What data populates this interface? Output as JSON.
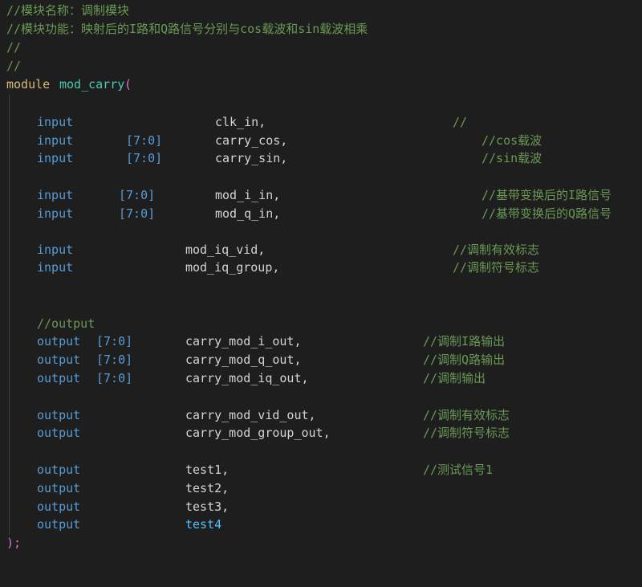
{
  "header_comments": [
    "//模块名称：调制模块",
    "//模块功能：映射后的I路和Q路信号分别与cos载波和sin载波相乘",
    "//",
    "//"
  ],
  "module_decl": {
    "keyword": "module",
    "name": "mod_carry",
    "open_paren": "("
  },
  "ports": [
    {
      "dir": "input",
      "range": "",
      "name": "clk_in,",
      "comment": "//"
    },
    {
      "dir": "input",
      "range": "[7:0]",
      "name": "carry_cos,",
      "comment": "//cos载波"
    },
    {
      "dir": "input",
      "range": "[7:0]",
      "name": "carry_sin,",
      "comment": "//sin载波"
    },
    {
      "dir": "input",
      "range": "[7:0]",
      "name": "mod_i_in,",
      "comment": "//基带变换后的I路信号"
    },
    {
      "dir": "input",
      "range": "[7:0]",
      "name": "mod_q_in,",
      "comment": "//基带变换后的Q路信号"
    },
    {
      "dir": "input",
      "range": "",
      "name": "mod_iq_vid,",
      "comment": "//调制有效标志"
    },
    {
      "dir": "input",
      "range": "",
      "name": "mod_iq_group,",
      "comment": "//调制符号标志"
    },
    {
      "dir": "",
      "range": "",
      "name": "",
      "comment": "//output"
    },
    {
      "dir": "output",
      "range": "[7:0]",
      "name": "carry_mod_i_out,",
      "comment": "//调制I路输出"
    },
    {
      "dir": "output",
      "range": "[7:0]",
      "name": "carry_mod_q_out,",
      "comment": "//调制Q路输出"
    },
    {
      "dir": "output",
      "range": "[7:0]",
      "name": "carry_mod_iq_out,",
      "comment": "//调制输出"
    },
    {
      "dir": "output",
      "range": "",
      "name": "carry_mod_vid_out,",
      "comment": "//调制有效标志"
    },
    {
      "dir": "output",
      "range": "",
      "name": "carry_mod_group_out,",
      "comment": "//调制符号标志"
    },
    {
      "dir": "output",
      "range": "",
      "name": "test1,",
      "comment": "//测试信号1"
    },
    {
      "dir": "output",
      "range": "",
      "name": "test2,",
      "comment": ""
    },
    {
      "dir": "output",
      "range": "",
      "name": "test3,",
      "comment": ""
    },
    {
      "dir": "output",
      "range": "",
      "name": "test4",
      "comment": ""
    }
  ],
  "closing": ");",
  "colors": {
    "background": "#1e1e1e",
    "comment": "#6a9955",
    "keyword": "#569cd6",
    "module_keyword": "#d7ba7d",
    "module_name": "#4ec9b0",
    "paren": "#da70d6",
    "identifier": "#d4d4d4",
    "last_identifier": "#4fc1ff"
  }
}
